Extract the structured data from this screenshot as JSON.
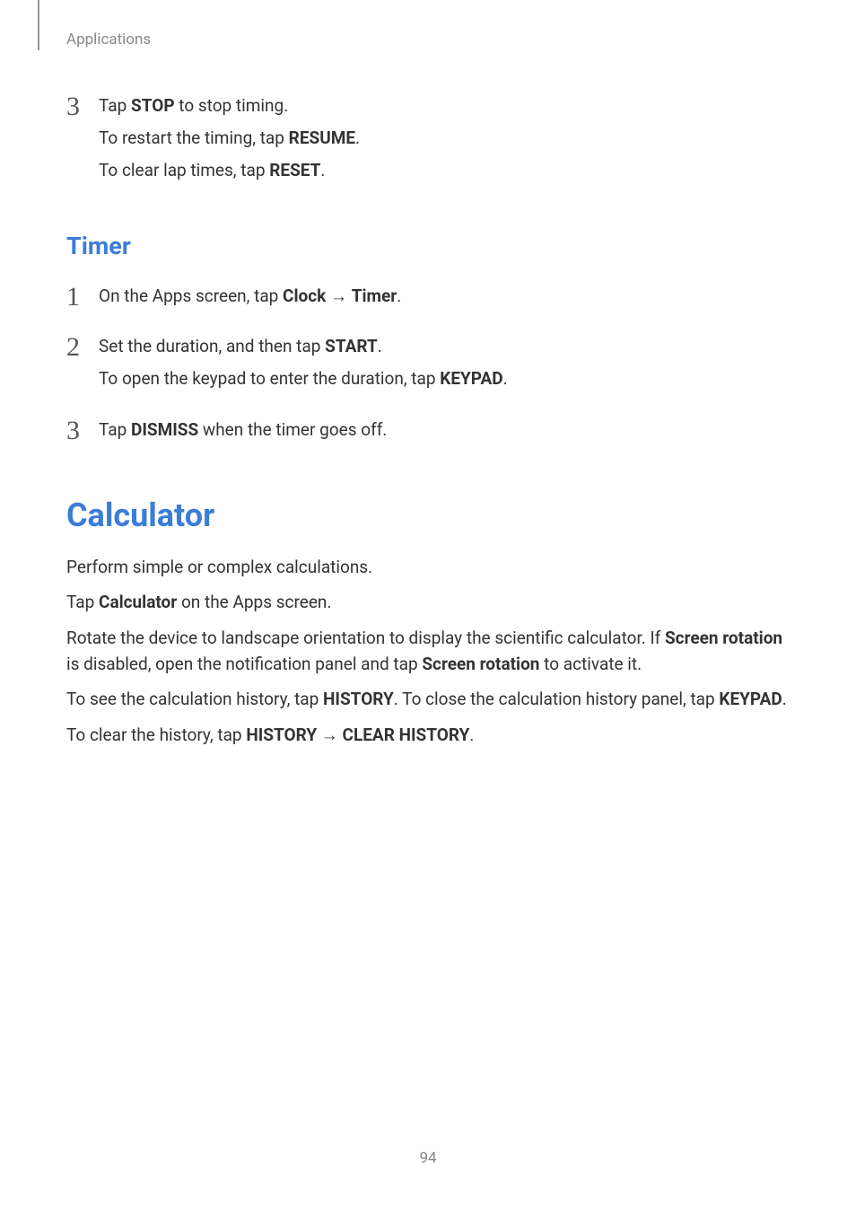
{
  "header": {
    "label": "Applications"
  },
  "stopwatch": {
    "step3": {
      "num": "3",
      "line1_pre": "Tap ",
      "line1_bold": "STOP",
      "line1_post": " to stop timing.",
      "line2_pre": "To restart the timing, tap ",
      "line2_bold": "RESUME",
      "line2_post": ".",
      "line3_pre": "To clear lap times, tap ",
      "line3_bold": "RESET",
      "line3_post": "."
    }
  },
  "timer": {
    "heading": "Timer",
    "step1": {
      "num": "1",
      "pre": "On the Apps screen, tap ",
      "bold1": "Clock",
      "arrow": " → ",
      "bold2": "Timer",
      "post": "."
    },
    "step2": {
      "num": "2",
      "line1_pre": "Set the duration, and then tap ",
      "line1_bold": "START",
      "line1_post": ".",
      "line2_pre": "To open the keypad to enter the duration, tap ",
      "line2_bold": "KEYPAD",
      "line2_post": "."
    },
    "step3": {
      "num": "3",
      "pre": "Tap ",
      "bold": "DISMISS",
      "post": " when the timer goes off."
    }
  },
  "calculator": {
    "heading": "Calculator",
    "p1": "Perform simple or complex calculations.",
    "p2_pre": "Tap ",
    "p2_bold": "Calculator",
    "p2_post": " on the Apps screen.",
    "p3_pre": "Rotate the device to landscape orientation to display the scientific calculator. If ",
    "p3_bold1": "Screen rotation",
    "p3_mid": " is disabled, open the notification panel and tap ",
    "p3_bold2": "Screen rotation",
    "p3_post": " to activate it.",
    "p4_pre": "To see the calculation history, tap ",
    "p4_bold1": "HISTORY",
    "p4_mid": ". To close the calculation history panel, tap ",
    "p4_bold2": "KEYPAD",
    "p4_post": ".",
    "p5_pre": "To clear the history, tap ",
    "p5_bold1": "HISTORY",
    "p5_arrow": " → ",
    "p5_bold2": "CLEAR HISTORY",
    "p5_post": "."
  },
  "pageNumber": "94"
}
